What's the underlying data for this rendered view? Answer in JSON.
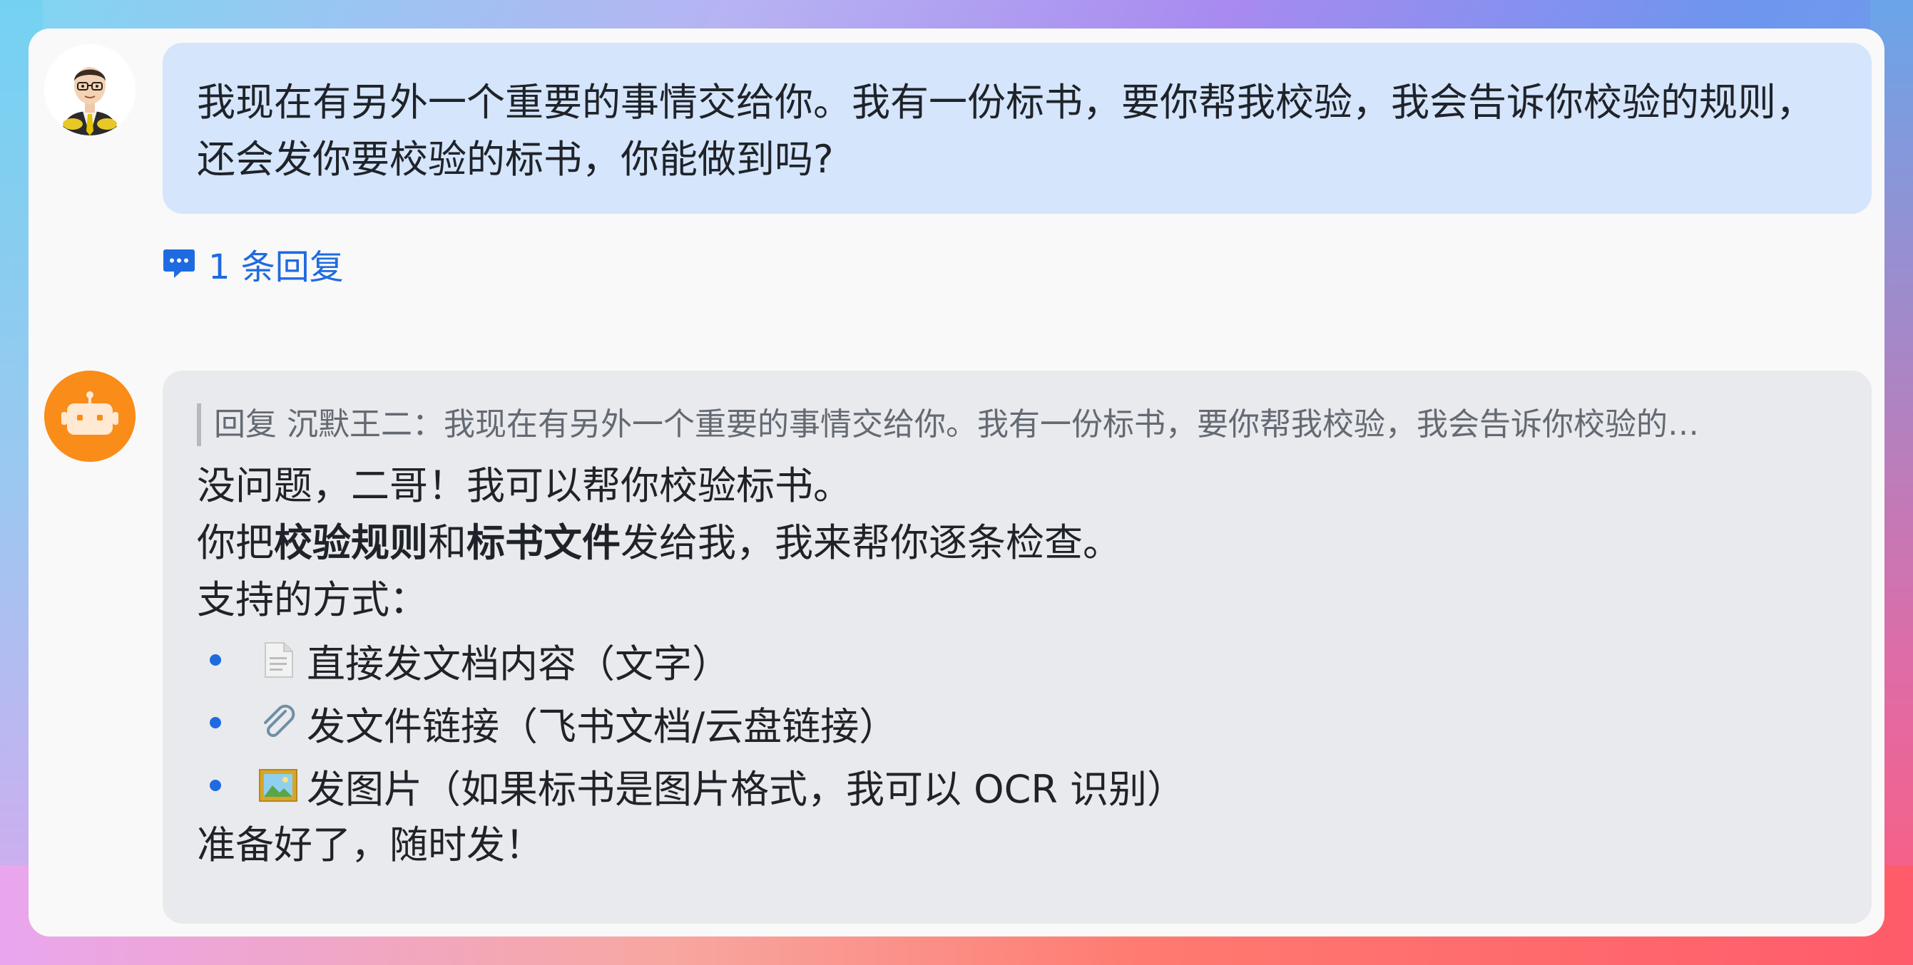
{
  "thread": {
    "user_message": {
      "text": "我现在有另外一个重要的事情交给你。我有一份标书，要你帮我校验，我会告诉你校验的规则，还会发你要校验的标书，你能做到吗?",
      "avatar_icon": "cartoon-man-avatar"
    },
    "reply_link": {
      "icon": "comment-icon",
      "label": "1 条回复"
    },
    "bot_message": {
      "avatar_icon": "robot-icon",
      "avatar_color": "#fa8c1a",
      "quote": "回复 沉默王二：我现在有另外一个重要的事情交给你。我有一份标书，要你帮我校验，我会告诉你校验的…",
      "line1": "没问题，二哥！我可以帮你校验标书。",
      "line2_prefix": "你把",
      "line2_bold1": "校验规则",
      "line2_mid": "和",
      "line2_bold2": "标书文件",
      "line2_suffix": "发给我，我来帮你逐条检查。",
      "line3": "支持的方式：",
      "options": [
        {
          "icon": "document-icon",
          "label": "直接发文档内容（文字）"
        },
        {
          "icon": "paperclip-icon",
          "label": "发文件链接（飞书文档/云盘链接）"
        },
        {
          "icon": "framed-picture-icon",
          "label": "发图片（如果标书是图片格式，我可以 OCR 识别）"
        }
      ],
      "closing": "准备好了，随时发！"
    }
  },
  "colors": {
    "accent": "#1f6ae0",
    "user_bubble": "#d5e5fc",
    "bot_bubble": "#e9eaed"
  }
}
